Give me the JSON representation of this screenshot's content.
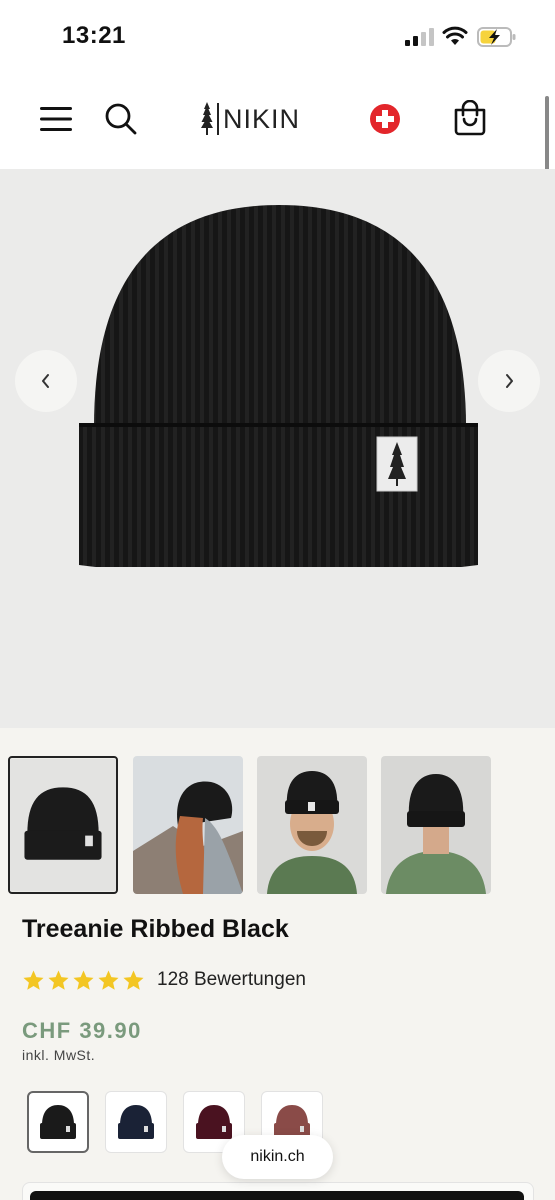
{
  "status_bar": {
    "time": "13:21"
  },
  "header": {
    "logo_text": "NIKIN"
  },
  "colors": {
    "accent_price": "#7a9a7d",
    "star": "#f3c623",
    "swiss_red": "#e3262b"
  },
  "product": {
    "title": "Treeanie Ribbed Black",
    "rating_stars": 5,
    "reviews_label": "128 Bewertungen",
    "price": "CHF 39.90",
    "tax_note": "inkl. MwSt."
  },
  "gallery": {
    "thumbnails": [
      "black beanie product",
      "woman wearing beanie side view",
      "man wearing beanie front",
      "man wearing beanie back"
    ],
    "active_index": 0
  },
  "swatches": [
    "black",
    "navy",
    "burgundy",
    "rose-brown"
  ],
  "browser": {
    "url": "nikin.ch"
  },
  "icons": [
    "menu-icon",
    "search-icon",
    "swiss-cross-icon",
    "shopping-bag-icon",
    "chevron-left-icon",
    "chevron-right-icon",
    "star-icon"
  ]
}
